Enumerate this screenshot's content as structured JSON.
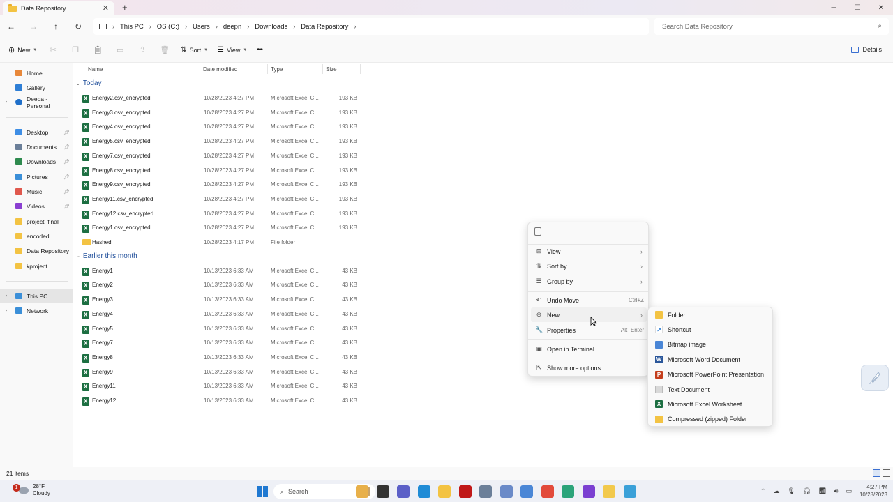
{
  "window": {
    "tab_title": "Data Repository",
    "close_glyph": "✕",
    "new_tab_glyph": "+",
    "controls": [
      "─",
      "☐",
      "✕"
    ]
  },
  "nav": {
    "back": "←",
    "forward": "→",
    "up": "↑",
    "refresh": "↻"
  },
  "breadcrumb": [
    "This PC",
    "OS (C:)",
    "Users",
    "deepn",
    "Downloads",
    "Data Repository"
  ],
  "search": {
    "placeholder": "Search Data Repository"
  },
  "toolbar": {
    "new_label": "New",
    "sort_label": "Sort",
    "view_label": "View",
    "more_label": "•••",
    "details_label": "Details"
  },
  "sidebar": {
    "items": [
      {
        "label": "Home",
        "icon": "home-icon",
        "color": "#e8883a"
      },
      {
        "label": "Gallery",
        "icon": "gallery-icon",
        "color": "#2f7fd6"
      },
      {
        "label": "Deepa - Personal",
        "icon": "onedrive-icon",
        "color": "#1f6fc9"
      },
      {
        "label": "Desktop",
        "icon": "desktop-icon",
        "color": "#3e8ee5"
      },
      {
        "label": "Documents",
        "icon": "documents-icon",
        "color": "#6b7f99"
      },
      {
        "label": "Downloads",
        "icon": "downloads-icon",
        "color": "#2e8a4e"
      },
      {
        "label": "Pictures",
        "icon": "pictures-icon",
        "color": "#3b8fd8"
      },
      {
        "label": "Music",
        "icon": "music-icon",
        "color": "#e0584d"
      },
      {
        "label": "Videos",
        "icon": "videos-icon",
        "color": "#8a3fd1"
      },
      {
        "label": "project_final",
        "icon": "folder-icon",
        "color": "#f3c343"
      },
      {
        "label": "encoded",
        "icon": "folder-icon",
        "color": "#f3c343"
      },
      {
        "label": "Data Repository",
        "icon": "folder-icon",
        "color": "#f3c343"
      },
      {
        "label": "kproject",
        "icon": "folder-icon",
        "color": "#f3c343"
      },
      {
        "label": "This PC",
        "icon": "this-pc-icon",
        "color": "#3b8fd8"
      },
      {
        "label": "Network",
        "icon": "network-icon",
        "color": "#3b8fd8"
      }
    ]
  },
  "columns": {
    "name": "Name",
    "date": "Date modified",
    "type": "Type",
    "size": "Size"
  },
  "groups": [
    {
      "label": "Today",
      "rows": [
        {
          "name": "Energy2.csv_encrypted",
          "date": "10/28/2023 4:27 PM",
          "type": "Microsoft Excel C...",
          "size": "193 KB",
          "icon": "excel-icon"
        },
        {
          "name": "Energy3.csv_encrypted",
          "date": "10/28/2023 4:27 PM",
          "type": "Microsoft Excel C...",
          "size": "193 KB",
          "icon": "excel-icon"
        },
        {
          "name": "Energy4.csv_encrypted",
          "date": "10/28/2023 4:27 PM",
          "type": "Microsoft Excel C...",
          "size": "193 KB",
          "icon": "excel-icon"
        },
        {
          "name": "Energy5.csv_encrypted",
          "date": "10/28/2023 4:27 PM",
          "type": "Microsoft Excel C...",
          "size": "193 KB",
          "icon": "excel-icon"
        },
        {
          "name": "Energy7.csv_encrypted",
          "date": "10/28/2023 4:27 PM",
          "type": "Microsoft Excel C...",
          "size": "193 KB",
          "icon": "excel-icon"
        },
        {
          "name": "Energy8.csv_encrypted",
          "date": "10/28/2023 4:27 PM",
          "type": "Microsoft Excel C...",
          "size": "193 KB",
          "icon": "excel-icon"
        },
        {
          "name": "Energy9.csv_encrypted",
          "date": "10/28/2023 4:27 PM",
          "type": "Microsoft Excel C...",
          "size": "193 KB",
          "icon": "excel-icon"
        },
        {
          "name": "Energy11.csv_encrypted",
          "date": "10/28/2023 4:27 PM",
          "type": "Microsoft Excel C...",
          "size": "193 KB",
          "icon": "excel-icon"
        },
        {
          "name": "Energy12.csv_encrypted",
          "date": "10/28/2023 4:27 PM",
          "type": "Microsoft Excel C...",
          "size": "193 KB",
          "icon": "excel-icon"
        },
        {
          "name": "Energy1.csv_encrypted",
          "date": "10/28/2023 4:27 PM",
          "type": "Microsoft Excel C...",
          "size": "193 KB",
          "icon": "excel-icon"
        },
        {
          "name": "Hashed",
          "date": "10/28/2023 4:17 PM",
          "type": "File folder",
          "size": "",
          "icon": "folder-icon"
        }
      ]
    },
    {
      "label": "Earlier this month",
      "rows": [
        {
          "name": "Energy1",
          "date": "10/13/2023 6:33 AM",
          "type": "Microsoft Excel C...",
          "size": "43 KB",
          "icon": "excel-icon"
        },
        {
          "name": "Energy2",
          "date": "10/13/2023 6:33 AM",
          "type": "Microsoft Excel C...",
          "size": "43 KB",
          "icon": "excel-icon"
        },
        {
          "name": "Energy3",
          "date": "10/13/2023 6:33 AM",
          "type": "Microsoft Excel C...",
          "size": "43 KB",
          "icon": "excel-icon"
        },
        {
          "name": "Energy4",
          "date": "10/13/2023 6:33 AM",
          "type": "Microsoft Excel C...",
          "size": "43 KB",
          "icon": "excel-icon"
        },
        {
          "name": "Energy5",
          "date": "10/13/2023 6:33 AM",
          "type": "Microsoft Excel C...",
          "size": "43 KB",
          "icon": "excel-icon"
        },
        {
          "name": "Energy7",
          "date": "10/13/2023 6:33 AM",
          "type": "Microsoft Excel C...",
          "size": "43 KB",
          "icon": "excel-icon"
        },
        {
          "name": "Energy8",
          "date": "10/13/2023 6:33 AM",
          "type": "Microsoft Excel C...",
          "size": "43 KB",
          "icon": "excel-icon"
        },
        {
          "name": "Energy9",
          "date": "10/13/2023 6:33 AM",
          "type": "Microsoft Excel C...",
          "size": "43 KB",
          "icon": "excel-icon"
        },
        {
          "name": "Energy11",
          "date": "10/13/2023 6:33 AM",
          "type": "Microsoft Excel C...",
          "size": "43 KB",
          "icon": "excel-icon"
        },
        {
          "name": "Energy12",
          "date": "10/13/2023 6:33 AM",
          "type": "Microsoft Excel C...",
          "size": "43 KB",
          "icon": "excel-icon"
        }
      ]
    }
  ],
  "status": {
    "item_count": "21 items"
  },
  "context_menu": {
    "items": [
      {
        "label": "View",
        "icon": "view-icon",
        "glyph": "⊞",
        "submenu": true,
        "key": ""
      },
      {
        "label": "Sort by",
        "icon": "sort-icon",
        "glyph": "⇅",
        "submenu": true,
        "key": ""
      },
      {
        "label": "Group by",
        "icon": "group-icon",
        "glyph": "☰",
        "submenu": true,
        "key": ""
      },
      {
        "label": "Undo Move",
        "icon": "undo-icon",
        "glyph": "↶",
        "submenu": false,
        "key": "Ctrl+Z"
      },
      {
        "label": "New",
        "icon": "new-icon",
        "glyph": "⊕",
        "submenu": true,
        "key": ""
      },
      {
        "label": "Properties",
        "icon": "properties-icon",
        "glyph": "🔧",
        "submenu": false,
        "key": "Alt+Enter"
      },
      {
        "label": "Open in Terminal",
        "icon": "terminal-icon",
        "glyph": "▣",
        "submenu": false,
        "key": ""
      },
      {
        "label": "Show more options",
        "icon": "more-options-icon",
        "glyph": "⇱",
        "submenu": false,
        "key": ""
      }
    ],
    "arrow_glyph": "›"
  },
  "submenu": {
    "items": [
      {
        "label": "Folder",
        "icon": "folder-icon",
        "color": "#f3c343",
        "glyph": ""
      },
      {
        "label": "Shortcut",
        "icon": "shortcut-icon",
        "color": "#ffffff",
        "glyph": "↗"
      },
      {
        "label": "Bitmap image",
        "icon": "bitmap-icon",
        "color": "#4a86d6",
        "glyph": ""
      },
      {
        "label": "Microsoft Word Document",
        "icon": "word-icon",
        "color": "#2b579a",
        "glyph": "W"
      },
      {
        "label": "Microsoft PowerPoint Presentation",
        "icon": "powerpoint-icon",
        "color": "#c43e1c",
        "glyph": "P"
      },
      {
        "label": "Text Document",
        "icon": "text-document-icon",
        "color": "#d9d9d9",
        "glyph": ""
      },
      {
        "label": "Microsoft Excel Worksheet",
        "icon": "excel-icon",
        "color": "#1d6f42",
        "glyph": "X"
      },
      {
        "label": "Compressed (zipped) Folder",
        "icon": "zip-folder-icon",
        "color": "#f3c343",
        "glyph": ""
      }
    ]
  },
  "taskbar": {
    "weather_temp": "28°F",
    "weather_desc": "Cloudy",
    "weather_badge": "1",
    "search_label": "Search",
    "time": "4:27 PM",
    "date": "10/28/2023",
    "tray_expand": "⌃",
    "apps": [
      {
        "name": "file-manager-app",
        "color": "#e8b04a"
      },
      {
        "name": "task-view-app",
        "color": "#333333"
      },
      {
        "name": "teams-app",
        "color": "#5b5fc7"
      },
      {
        "name": "edge-app",
        "color": "#1f8bd6"
      },
      {
        "name": "explorer-app",
        "color": "#f3c343"
      },
      {
        "name": "mcafee-app",
        "color": "#c01818"
      },
      {
        "name": "pen-app",
        "color": "#6b7f99"
      },
      {
        "name": "r-app",
        "color": "#6a8ac8"
      },
      {
        "name": "image-app",
        "color": "#4a86d6"
      },
      {
        "name": "chrome-app",
        "color": "#e24a3b"
      },
      {
        "name": "notepad-app",
        "color": "#2aa37a"
      },
      {
        "name": "media-app",
        "color": "#7a3fd1"
      },
      {
        "name": "sticky-app",
        "color": "#f2c94c"
      },
      {
        "name": "snipping-app",
        "color": "#3aa0d8"
      }
    ]
  }
}
